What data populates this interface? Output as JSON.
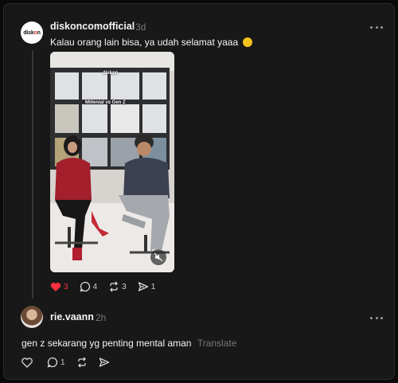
{
  "post": {
    "brand_avatar_text": "disk",
    "brand_avatar_o": "o",
    "brand_avatar_rest": "n",
    "username": "diskoncomofficial",
    "time": "3d",
    "text": "Kalau orang lain bisa, ya udah selamat yaaa",
    "emoji": "smile-emoji",
    "video_overlay_logo": "diskon",
    "video_overlay_title": "Millenial vs Gen Z",
    "likes": "3",
    "comments": "4",
    "reposts": "3",
    "shares": "1",
    "liked": true,
    "like_color": "#ff3040"
  },
  "reply": {
    "username": "rie.vaann",
    "time": "2h",
    "text": "gen z sekarang yg penting mental aman",
    "translate_label": "Translate",
    "comments": "1"
  },
  "icons": {
    "more": "more-horizontal-icon",
    "heart": "heart-icon",
    "comment": "comment-icon",
    "repost": "repost-icon",
    "share": "share-icon",
    "mute": "mute-icon"
  }
}
